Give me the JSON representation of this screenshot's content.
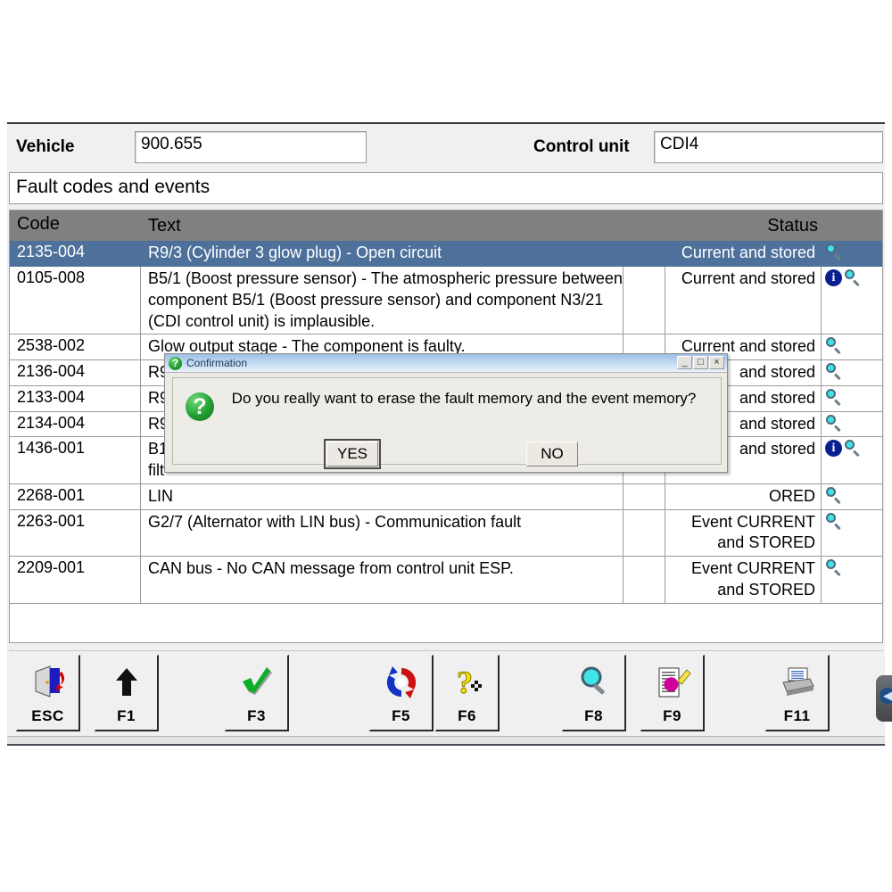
{
  "header": {
    "vehicle_label": "Vehicle",
    "vehicle_value": "900.655",
    "control_unit_label": "Control unit",
    "control_unit_value": "CDI4"
  },
  "screen_title": "Fault codes and events",
  "table": {
    "columns": [
      "Code",
      "Text",
      "Status"
    ],
    "rows": [
      {
        "code": "2135-004",
        "text": "R9/3 (Cylinder 3 glow plug) - Open circuit",
        "status": "Current and stored",
        "icons": [
          "magnifier-icon"
        ],
        "selected": true
      },
      {
        "code": "0105-008",
        "text": "B5/1 (Boost pressure sensor) - The atmospheric pressure between component B5/1 (Boost pressure sensor) and component N3/21 (CDI control unit) is implausible.",
        "status": "Current and stored",
        "icons": [
          "info-icon",
          "magnifier-icon"
        ],
        "selected": false
      },
      {
        "code": "2538-002",
        "text": "Glow output stage - The component is faulty.",
        "status": "Current and stored",
        "icons": [
          "magnifier-icon"
        ],
        "selected": false
      },
      {
        "code": "2136-004",
        "text": "R9",
        "status": "and stored",
        "icons": [
          "magnifier-icon"
        ],
        "selected": false
      },
      {
        "code": "2133-004",
        "text": "R9",
        "status": "and stored",
        "icons": [
          "magnifier-icon"
        ],
        "selected": false
      },
      {
        "code": "2134-004",
        "text": "R9",
        "status": "and stored",
        "icons": [
          "magnifier-icon"
        ],
        "selected": false
      },
      {
        "code": "1436-001",
        "text": "B1\nfilt",
        "status": "and stored",
        "icons": [
          "info-icon",
          "magnifier-icon"
        ],
        "selected": false
      },
      {
        "code": "2268-001",
        "text": "LIN",
        "status": "ORED",
        "icons": [
          "magnifier-icon"
        ],
        "selected": false
      },
      {
        "code": "2263-001",
        "text": "G2/7 (Alternator with LIN bus) - Communication fault",
        "status": "Event CURRENT and STORED",
        "icons": [
          "magnifier-icon"
        ],
        "selected": false
      },
      {
        "code": "2209-001",
        "text": "CAN bus - No CAN message from control unit ESP.",
        "status": "Event CURRENT and STORED",
        "icons": [
          "magnifier-icon"
        ],
        "selected": false
      }
    ]
  },
  "toolbar": {
    "buttons": [
      {
        "key": "ESC",
        "icon": "exit-door-icon"
      },
      {
        "key": "F1",
        "icon": "up-arrow-icon"
      },
      {
        "key": "F3",
        "icon": "green-check-icon"
      },
      {
        "key": "F5",
        "icon": "refresh-circle-icon"
      },
      {
        "key": "F6",
        "icon": "yellow-question-icon"
      },
      {
        "key": "F8",
        "icon": "magnifier-icon"
      },
      {
        "key": "F9",
        "icon": "document-erase-icon"
      },
      {
        "key": "F11",
        "icon": "printer-icon"
      }
    ]
  },
  "dialog": {
    "title": "Confirmation",
    "title_icon": "green-question-icon",
    "message_icon": "green-question-icon",
    "message": "Do you really want to erase the fault memory and the event memory?",
    "yes_label": "YES",
    "no_label": "NO",
    "window_buttons": [
      "minimize",
      "maximize",
      "close"
    ],
    "window_glyphs": {
      "minimize": "_",
      "maximize": "□",
      "close": "×"
    }
  },
  "edge_nav": {
    "icon": "back-arrow-icon",
    "glyph": "◀"
  },
  "colors": {
    "header_row": "#808080",
    "selected_row": "#4d719b",
    "dialog_title_bar": "#9cc0e6",
    "info_icon": "#0a1f8f",
    "magnifier": "#3fe3e8"
  }
}
